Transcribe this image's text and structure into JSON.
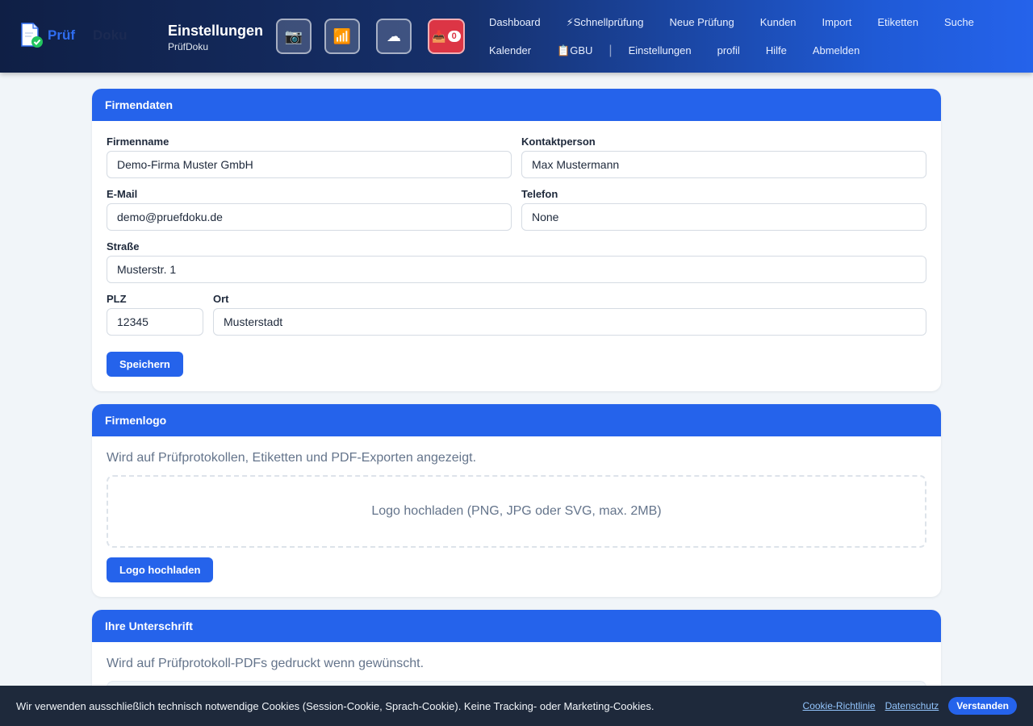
{
  "header": {
    "logo_part1": "Prüf",
    "logo_part2": "Doku",
    "page_title": "Einstellungen",
    "page_subtitle": "PrüfDoku",
    "inbox_count": "0",
    "icon_buttons": [
      "camera-icon",
      "signal-icon",
      "cloud-icon",
      "inbox-icon"
    ]
  },
  "nav": {
    "row1": [
      "Dashboard",
      "⚡Schnellprüfung",
      "Neue Prüfung",
      "Kunden",
      "Import",
      "Etiketten",
      "Suche"
    ],
    "row2": [
      "Kalender",
      "📋GBU",
      "Einstellungen",
      "profil",
      "Hilfe",
      "Abmelden"
    ]
  },
  "firmendaten": {
    "title": "Firmendaten",
    "firmenname_label": "Firmenname",
    "firmenname_value": "Demo-Firma Muster GmbH",
    "kontakt_label": "Kontaktperson",
    "kontakt_value": "Max Mustermann",
    "email_label": "E-Mail",
    "email_value": "demo@pruefdoku.de",
    "telefon_label": "Telefon",
    "telefon_value": "None",
    "strasse_label": "Straße",
    "strasse_value": "Musterstr. 1",
    "plz_label": "PLZ",
    "plz_value": "12345",
    "ort_label": "Ort",
    "ort_value": "Musterstadt",
    "save_label": "Speichern"
  },
  "firmenlogo": {
    "title": "Firmenlogo",
    "description": "Wird auf Prüfprotokollen, Etiketten und PDF-Exporten angezeigt.",
    "dropzone_text": "Logo hochladen (PNG, JPG oder SVG, max. 2MB)",
    "upload_label": "Logo hochladen"
  },
  "unterschrift": {
    "title": "Ihre Unterschrift",
    "description": "Wird auf Prüfprotokoll-PDFs gedruckt wenn gewünscht."
  },
  "cookie": {
    "message": "Wir verwenden ausschließlich technisch notwendige Cookies (Session-Cookie, Sprach-Cookie). Keine Tracking- oder Marketing-Cookies.",
    "link_policy": "Cookie-Richtlinie",
    "link_privacy": "Datenschutz",
    "accept_label": "Verstanden"
  },
  "colors": {
    "primary": "#2563eb",
    "header_dark": "#0f1f45",
    "danger": "#dc3545",
    "cookie_bg": "#1e293b"
  }
}
